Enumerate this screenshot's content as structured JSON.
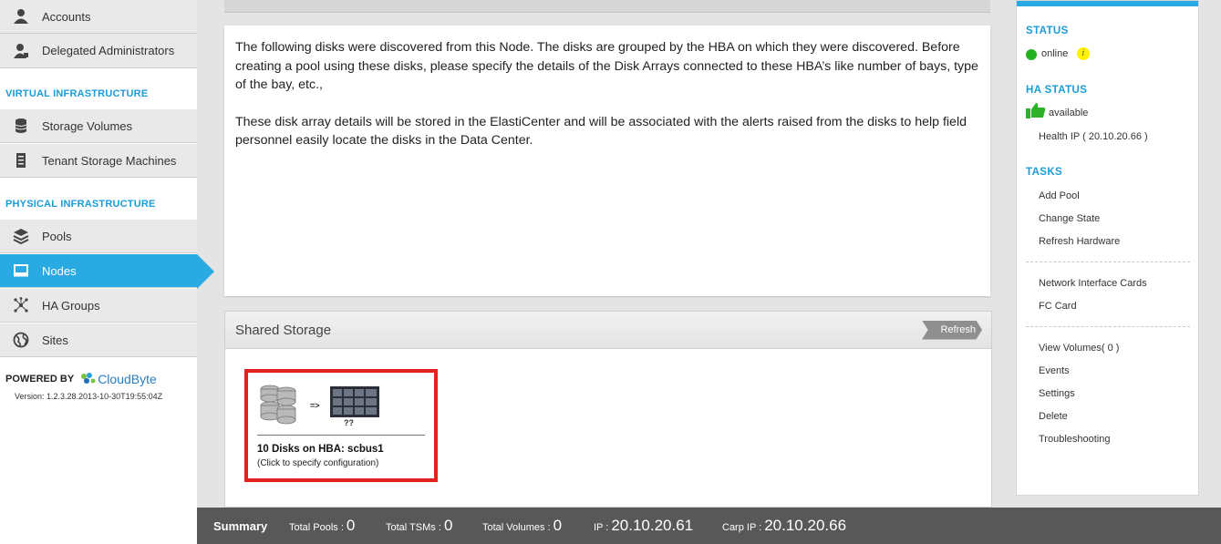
{
  "sidebar": {
    "items_top": [
      {
        "label": "Accounts",
        "icon": "user-icon"
      },
      {
        "label": "Delegated Administrators",
        "icon": "admin-user-icon"
      }
    ],
    "virtual_title": "VIRTUAL INFRASTRUCTURE",
    "virtual_items": [
      {
        "label": "Storage Volumes",
        "icon": "database-icon"
      },
      {
        "label": "Tenant Storage Machines",
        "icon": "server-icon"
      }
    ],
    "physical_title": "PHYSICAL INFRASTRUCTURE",
    "physical_items": [
      {
        "label": "Pools",
        "icon": "layers-icon"
      },
      {
        "label": "Nodes",
        "icon": "node-icon",
        "active": true
      },
      {
        "label": "HA Groups",
        "icon": "network-icon"
      },
      {
        "label": "Sites",
        "icon": "globe-icon"
      }
    ],
    "powered_by": "POWERED BY",
    "logo_text": "CloudByte",
    "version": "Version: 1.2.3.28.2013-10-30T19:55:04Z"
  },
  "main": {
    "info_paragraph_1": "The following disks were discovered from this Node. The disks are grouped by the HBA on which they were discovered. Before creating a pool using these disks, please specify the details of the Disk Arrays connected to these HBA’s like number of bays, type of the bay, etc.,",
    "info_paragraph_2": "These disk array details will be stored in the ElastiCenter and will be associated with the alerts raised from the disks to help field personnel easily locate the disks in the Data Center.",
    "shared_storage_title": "Shared Storage",
    "refresh_label": "Refresh",
    "hba_card": {
      "arrow": "=>",
      "unknown": "??",
      "title": "10 Disks on HBA: scbus1",
      "subtitle": "(Click to specify configuration)"
    }
  },
  "right_panel": {
    "status_title": "STATUS",
    "status_value": "online",
    "info_badge": "i",
    "ha_status_title": "HA STATUS",
    "ha_status_value": "available",
    "health_ip": "Health IP ( 20.10.20.66 )",
    "tasks_title": "TASKS",
    "tasks_group1": [
      "Add Pool",
      "Change State",
      "Refresh Hardware"
    ],
    "tasks_group2": [
      "Network Interface Cards",
      "FC Card"
    ],
    "tasks_group3": [
      "View Volumes( 0 )",
      "Events",
      "Settings",
      "Delete",
      "Troubleshooting"
    ]
  },
  "summary": {
    "label": "Summary",
    "total_pools_label": "Total Pools :",
    "total_pools": "0",
    "total_tsms_label": "Total TSMs :",
    "total_tsms": "0",
    "total_volumes_label": "Total Volumes :",
    "total_volumes": "0",
    "ip_label": "IP :",
    "ip": "20.10.20.61",
    "carp_ip_label": "Carp IP :",
    "carp_ip": "20.10.20.66"
  },
  "colors": {
    "accent": "#29aae2",
    "section_title": "#1a9cd8",
    "highlight_border": "#e1231f",
    "online": "#22b11f"
  }
}
